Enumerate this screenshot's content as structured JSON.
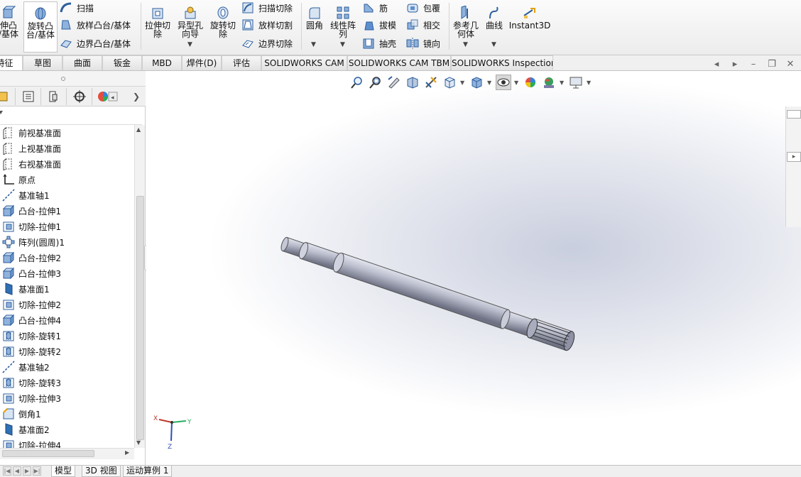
{
  "ribbon": {
    "extrude_boss_label": "伸凸\n/基体",
    "revolve_boss_label": "旋转凸\n台/基体",
    "sweep_label": "扫描",
    "loft_boss_label": "放样凸台/基体",
    "boundary_boss_label": "边界凸台/基体",
    "extrude_cut_label": "拉伸切\n除",
    "hole_wizard_label": "异型孔\n向导",
    "revolve_cut_label": "旋转切\n除",
    "swept_cut_label": "扫描切除",
    "lofted_cut_label": "放样切割",
    "boundary_cut_label": "边界切除",
    "fillet_label": "圆角",
    "linear_pattern_label": "线性阵\n列",
    "rib_label": "筋",
    "draft_label": "拔模",
    "shell_label": "抽壳",
    "wrap_label": "包覆",
    "intersect_label": "相交",
    "mirror_label": "镜向",
    "ref_geometry_label": "参考几\n何体",
    "curves_label": "曲线",
    "instant3d_label": "Instant3D"
  },
  "tabs": [
    "特征",
    "草图",
    "曲面",
    "钣金",
    "MBD",
    "焊件(D)",
    "评估",
    "SOLIDWORKS CAM",
    "SOLIDWORKS CAM TBM",
    "SOLIDWORKS Inspection"
  ],
  "feature_tree": [
    {
      "label": "前视基准面",
      "icon": "plane-icon"
    },
    {
      "label": "上视基准面",
      "icon": "plane-icon"
    },
    {
      "label": "右视基准面",
      "icon": "plane-icon"
    },
    {
      "label": "原点",
      "icon": "origin-icon"
    },
    {
      "label": "基准轴1",
      "icon": "axis-icon"
    },
    {
      "label": "凸台-拉伸1",
      "icon": "boss-extrude-icon"
    },
    {
      "label": "切除-拉伸1",
      "icon": "cut-extrude-icon"
    },
    {
      "label": "阵列(圆周)1",
      "icon": "circular-pattern-icon"
    },
    {
      "label": "凸台-拉伸2",
      "icon": "boss-extrude-icon"
    },
    {
      "label": "凸台-拉伸3",
      "icon": "boss-extrude-icon"
    },
    {
      "label": "基准面1",
      "icon": "datum-plane-icon"
    },
    {
      "label": "切除-拉伸2",
      "icon": "cut-extrude-icon"
    },
    {
      "label": "凸台-拉伸4",
      "icon": "boss-extrude-icon"
    },
    {
      "label": "切除-旋转1",
      "icon": "cut-revolve-icon"
    },
    {
      "label": "切除-旋转2",
      "icon": "cut-revolve-icon"
    },
    {
      "label": "基准轴2",
      "icon": "axis-icon"
    },
    {
      "label": "切除-旋转3",
      "icon": "cut-revolve-icon"
    },
    {
      "label": "切除-拉伸3",
      "icon": "cut-extrude-icon"
    },
    {
      "label": "倒角1",
      "icon": "chamfer-icon"
    },
    {
      "label": "基准面2",
      "icon": "datum-plane-icon"
    },
    {
      "label": "切除-拉伸4",
      "icon": "cut-extrude-icon"
    }
  ],
  "triad": {
    "x": "X",
    "y": "Y",
    "z": "Z"
  },
  "bottom_tabs": [
    "模型",
    "3D 视图",
    "运动算例 1"
  ],
  "colors": {
    "accent": "#1e5fb4",
    "tree_icon": "#2c5f9e",
    "shaft": "#b9bccb"
  }
}
